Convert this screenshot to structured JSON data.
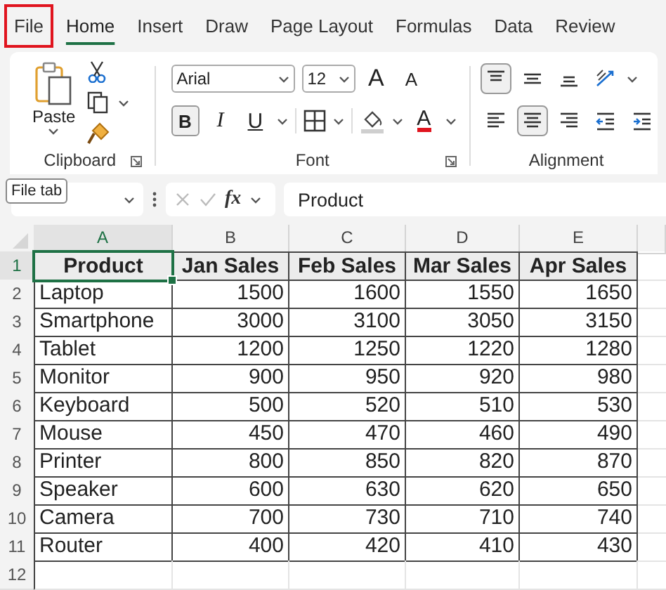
{
  "tabs": [
    {
      "label": "File",
      "selected": false,
      "highlighted": true
    },
    {
      "label": "Home",
      "selected": true,
      "highlighted": false
    },
    {
      "label": "Insert",
      "selected": false,
      "highlighted": false
    },
    {
      "label": "Draw",
      "selected": false,
      "highlighted": false
    },
    {
      "label": "Page Layout",
      "selected": false,
      "highlighted": false
    },
    {
      "label": "Formulas",
      "selected": false,
      "highlighted": false
    },
    {
      "label": "Data",
      "selected": false,
      "highlighted": false
    },
    {
      "label": "Review",
      "selected": false,
      "highlighted": false
    }
  ],
  "ribbon": {
    "clipboard": {
      "label": "Clipboard",
      "paste_label": "Paste"
    },
    "font": {
      "label": "Font",
      "font_name": "Arial",
      "font_size": "12",
      "buttons": [
        {
          "kind": "grow",
          "label": "A",
          "selected": false
        },
        {
          "kind": "shrink",
          "label": "A",
          "selected": false
        },
        {
          "kind": "bold",
          "label": "B",
          "selected": true
        },
        {
          "kind": "italic",
          "label": "I",
          "selected": false
        },
        {
          "kind": "underline",
          "label": "U",
          "selected": false
        },
        {
          "kind": "font_color",
          "label": "A",
          "selected": false
        }
      ]
    },
    "alignment": {
      "label": "Alignment",
      "buttons": [
        {
          "kind": "top",
          "selected": true
        },
        {
          "kind": "middle",
          "selected": false
        },
        {
          "kind": "bottom",
          "selected": false
        },
        {
          "kind": "orientation",
          "selected": false
        },
        {
          "kind": "left",
          "selected": false
        },
        {
          "kind": "center",
          "selected": true
        },
        {
          "kind": "right",
          "selected": false
        },
        {
          "kind": "outdent",
          "selected": false
        },
        {
          "kind": "indent",
          "selected": false
        }
      ]
    }
  },
  "tooltip": "File tab",
  "formula_bar": {
    "function_label": "fx",
    "value": "Product"
  },
  "sheet": {
    "columns": [
      {
        "label": "A",
        "selected": true
      },
      {
        "label": "B",
        "selected": false
      },
      {
        "label": "C",
        "selected": false
      },
      {
        "label": "D",
        "selected": false
      },
      {
        "label": "E",
        "selected": false
      }
    ],
    "rows": [
      {
        "number": "1",
        "kind": "header",
        "selected": true,
        "cells": [
          "Product",
          "Jan Sales",
          "Feb Sales",
          "Mar Sales",
          "Apr Sales"
        ]
      },
      {
        "number": "2",
        "kind": "data",
        "selected": false,
        "cells": [
          "Laptop",
          "1500",
          "1600",
          "1550",
          "1650"
        ]
      },
      {
        "number": "3",
        "kind": "data",
        "selected": false,
        "cells": [
          "Smartphone",
          "3000",
          "3100",
          "3050",
          "3150"
        ]
      },
      {
        "number": "4",
        "kind": "data",
        "selected": false,
        "cells": [
          "Tablet",
          "1200",
          "1250",
          "1220",
          "1280"
        ]
      },
      {
        "number": "5",
        "kind": "data",
        "selected": false,
        "cells": [
          "Monitor",
          "900",
          "950",
          "920",
          "980"
        ]
      },
      {
        "number": "6",
        "kind": "data",
        "selected": false,
        "cells": [
          "Keyboard",
          "500",
          "520",
          "510",
          "530"
        ]
      },
      {
        "number": "7",
        "kind": "data",
        "selected": false,
        "cells": [
          "Mouse",
          "450",
          "470",
          "460",
          "490"
        ]
      },
      {
        "number": "8",
        "kind": "data",
        "selected": false,
        "cells": [
          "Printer",
          "800",
          "850",
          "820",
          "870"
        ]
      },
      {
        "number": "9",
        "kind": "data",
        "selected": false,
        "cells": [
          "Speaker",
          "600",
          "630",
          "620",
          "650"
        ]
      },
      {
        "number": "10",
        "kind": "data",
        "selected": false,
        "cells": [
          "Camera",
          "700",
          "730",
          "710",
          "740"
        ]
      },
      {
        "number": "11",
        "kind": "data",
        "selected": false,
        "cells": [
          "Router",
          "400",
          "420",
          "410",
          "430"
        ]
      },
      {
        "number": "12",
        "kind": "empty",
        "selected": false
      }
    ]
  }
}
